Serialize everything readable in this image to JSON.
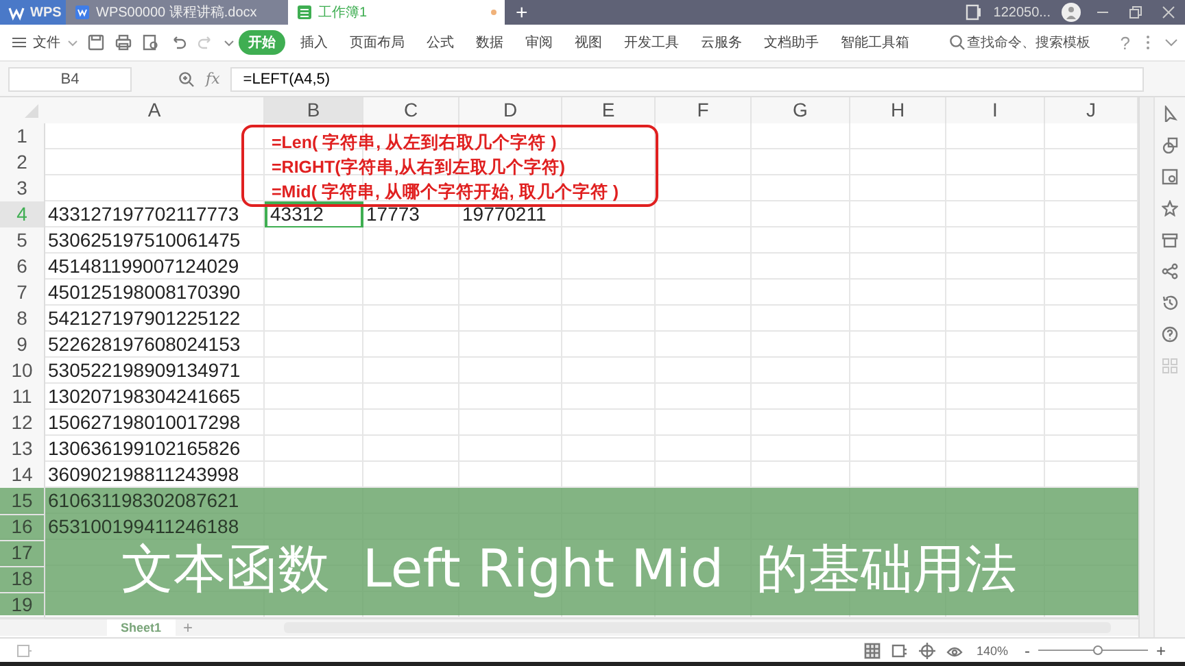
{
  "app_tabs": [
    {
      "label": "WPS",
      "kind": "home",
      "selected": false
    },
    {
      "label": "WPS00000 课程讲稿.docx",
      "kind": "doc",
      "selected": false
    },
    {
      "label": "工作簿1",
      "kind": "sheet",
      "selected": true
    }
  ],
  "new_tab": "+",
  "account": {
    "name": "122050..."
  },
  "menu": {
    "file": "文件",
    "tabs": [
      {
        "label": "开始",
        "selected": true
      },
      {
        "label": "插入",
        "selected": false
      },
      {
        "label": "页面布局",
        "selected": false
      },
      {
        "label": "公式",
        "selected": false
      },
      {
        "label": "数据",
        "selected": false
      },
      {
        "label": "审阅",
        "selected": false
      },
      {
        "label": "视图",
        "selected": false
      },
      {
        "label": "开发工具",
        "selected": false
      },
      {
        "label": "云服务",
        "selected": false
      },
      {
        "label": "文档助手",
        "selected": false
      },
      {
        "label": "智能工具箱",
        "selected": false
      }
    ],
    "search": {
      "placeholder": "查找命令、搜索模板"
    },
    "help": "?"
  },
  "formula_bar": {
    "cell_ref": "B4",
    "fx": "fx",
    "formula": "=LEFT(A4,5)"
  },
  "sheet": {
    "columns": [
      {
        "label": "A",
        "selected": false
      },
      {
        "label": "B",
        "selected": true
      },
      {
        "label": "C",
        "selected": false
      },
      {
        "label": "D",
        "selected": false
      },
      {
        "label": "E",
        "selected": false
      },
      {
        "label": "F",
        "selected": false
      },
      {
        "label": "G",
        "selected": false
      },
      {
        "label": "H",
        "selected": false
      },
      {
        "label": "I",
        "selected": false
      },
      {
        "label": "J",
        "selected": false
      }
    ],
    "rows": [
      {
        "number": "1",
        "selected": false
      },
      {
        "number": "2",
        "selected": false
      },
      {
        "number": "3",
        "selected": false
      },
      {
        "number": "4",
        "selected": true,
        "cells": [
          "433127197702117773",
          "43312",
          "17773",
          "19770211"
        ]
      },
      {
        "number": "5",
        "selected": false,
        "cells": [
          "530625197510061475"
        ]
      },
      {
        "number": "6",
        "selected": false,
        "cells": [
          "451481199007124029"
        ]
      },
      {
        "number": "7",
        "selected": false,
        "cells": [
          "450125198008170390"
        ]
      },
      {
        "number": "8",
        "selected": false,
        "cells": [
          "542127197901225122"
        ]
      },
      {
        "number": "9",
        "selected": false,
        "cells": [
          "522628197608024153"
        ]
      },
      {
        "number": "10",
        "selected": false,
        "cells": [
          "530522198909134971"
        ]
      },
      {
        "number": "11",
        "selected": false,
        "cells": [
          "130207198304241665"
        ]
      },
      {
        "number": "12",
        "selected": false,
        "cells": [
          "150627198010017298"
        ]
      },
      {
        "number": "13",
        "selected": false,
        "cells": [
          "130636199102165826"
        ]
      },
      {
        "number": "14",
        "selected": false,
        "cells": [
          "360902198811243998"
        ]
      },
      {
        "number": "15",
        "selected": false,
        "cells": [
          "610631198302087621"
        ]
      },
      {
        "number": "16",
        "selected": false,
        "cells": [
          "653100199411246188"
        ]
      },
      {
        "number": "17",
        "selected": false
      },
      {
        "number": "18",
        "selected": false
      },
      {
        "number": "19",
        "selected": false
      }
    ]
  },
  "note": {
    "lines": [
      "=Len( 字符串, 从左到右取几个字符 )",
      "=RIGHT(字符串,从右到左取几个字符)",
      "=Mid( 字符串, 从哪个字符开始, 取几个字符 )"
    ]
  },
  "sheet_tabs": [
    {
      "label": "Sheet1",
      "selected": true
    }
  ],
  "add_sheet": "+",
  "status_bar": {
    "zoom": "140%",
    "minus": "-",
    "plus": "+",
    "zoom_slider": {
      "level": 0.55
    }
  },
  "banner": {
    "title": "文本函数  Left Right Mid  的基础用法"
  }
}
